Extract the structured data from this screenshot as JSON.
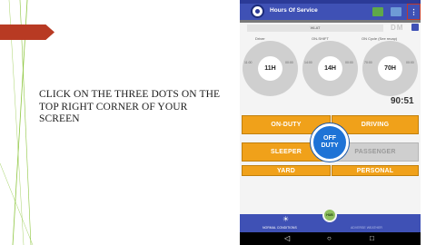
{
  "slide": {
    "instruction": "Click on the three dots on the top right corner of your screen",
    "accent_color": "#b83a23",
    "line_color": "#8dc63f"
  },
  "phone": {
    "app_bar": {
      "title": "Hours Of Service",
      "icons": [
        "logo-icon",
        "mail-icon",
        "truck-icon",
        "more-vert-icon"
      ],
      "more_label": "⋮"
    },
    "date_field": "WLAT",
    "dm_label": "DM",
    "gauges": [
      {
        "label": "Driver",
        "value": "11H",
        "left_tick": "11:00",
        "right_tick": "00:00"
      },
      {
        "label": "ON-SHIFT",
        "value": "14H",
        "left_tick": "14:00",
        "right_tick": "00:00"
      },
      {
        "label": "ON Cycle (See recap)",
        "value": "70H",
        "left_tick": "70:00",
        "right_tick": "00:00"
      }
    ],
    "timer": "90:51",
    "status_buttons": {
      "on_duty": "ON-DUTY",
      "driving": "DRIVING",
      "off_duty_line1": "OFF",
      "off_duty_line2": "DUTY",
      "sleeper": "SLEEPER",
      "passenger": "PASSENGER",
      "yard": "YARD",
      "personal": "PERSONAL"
    },
    "bottom_nav": {
      "left_label": "NORMAL CONDITIONS",
      "center_label": "HUB",
      "right_label": "ADVERSE WEATHER"
    },
    "colors": {
      "primary": "#3f51b5",
      "button": "#f0a11a",
      "off_duty": "#1e73d6"
    }
  }
}
